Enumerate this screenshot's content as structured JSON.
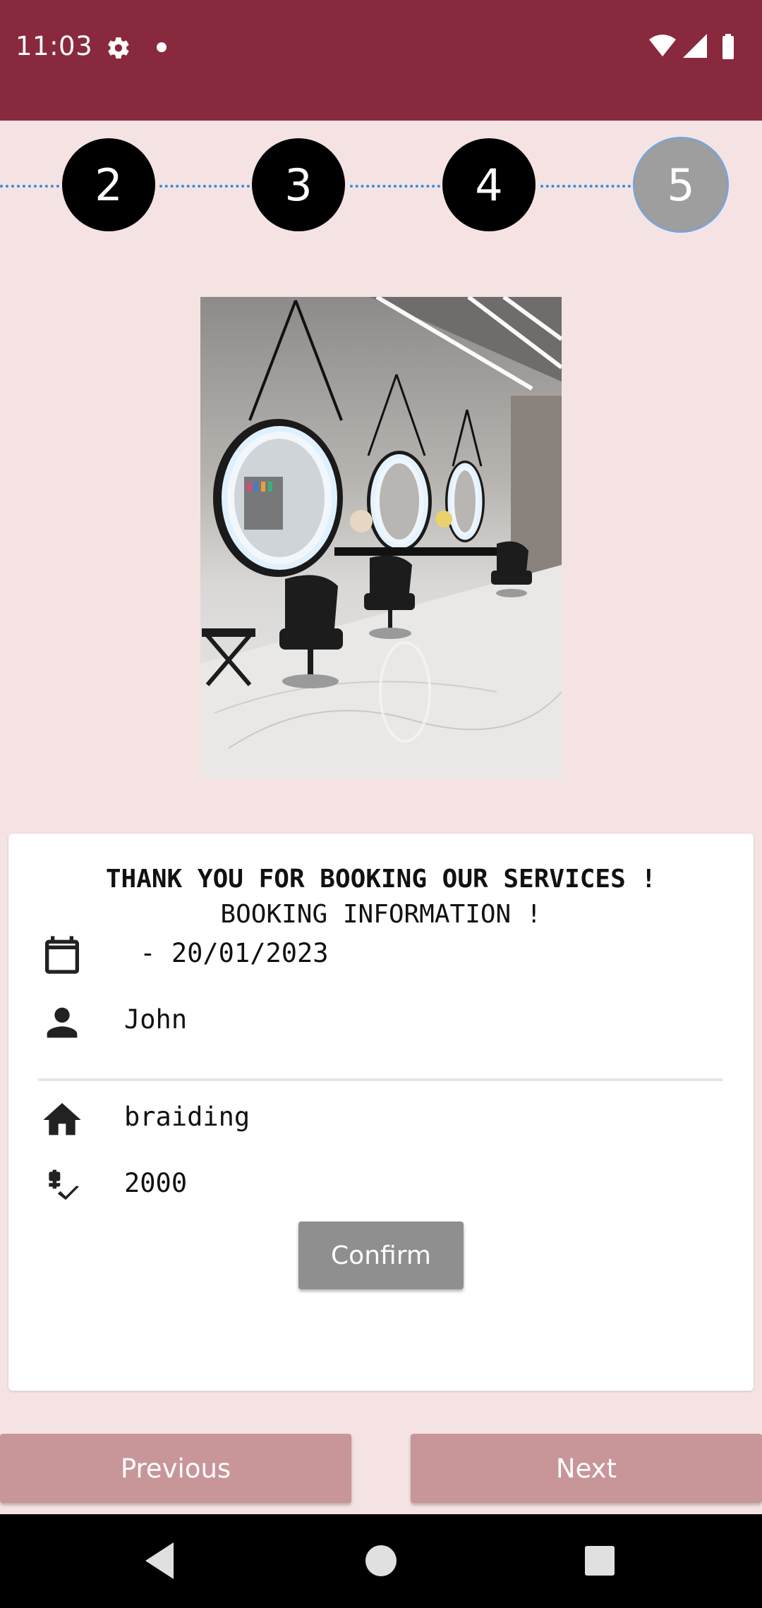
{
  "status_bar": {
    "time": "11:03",
    "icons": [
      "settings-icon",
      "notification-dot",
      "wifi-icon",
      "signal-icon",
      "battery-icon"
    ]
  },
  "stepper": {
    "steps": [
      "2",
      "3",
      "4",
      "5"
    ],
    "active_step": "5",
    "colors": {
      "inactive": "#000000",
      "active": "#9e9e9e",
      "connector": "#2f8fe0"
    }
  },
  "image": {
    "name": "salon-interior-photo"
  },
  "booking_card": {
    "title": "THANK YOU FOR BOOKING OUR SERVICES !",
    "subtitle": "BOOKING INFORMATION !",
    "date": " - 20/01/2023",
    "customer": "John",
    "service": "braiding",
    "price": "2000",
    "confirm_label": "Confirm"
  },
  "navigation": {
    "previous_label": "Previous",
    "next_label": "Next"
  },
  "colors": {
    "status_bar": "#88293e",
    "background": "#f5e3e4",
    "nav_button": "#c89598",
    "confirm_button": "#8f8f8f"
  }
}
